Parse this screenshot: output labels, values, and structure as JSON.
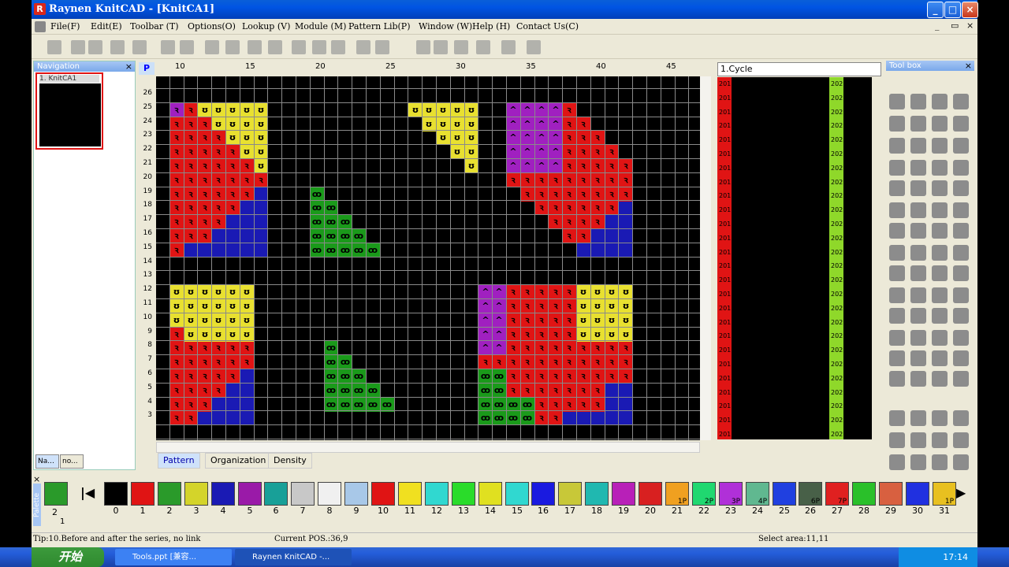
{
  "window": {
    "title": "Raynen KnitCAD - [KnitCA1]",
    "app_icon_letter": "R",
    "min": "_",
    "max": "□",
    "close": "×"
  },
  "menu": [
    "File(F)",
    "Edit(E)",
    "Toolbar (T)",
    "Options(O)",
    "Lookup (V)",
    "Module (M)",
    "Pattern Lib(P)",
    "Window (W)",
    "Help (H)",
    "Contact Us(C)"
  ],
  "navigation": {
    "title": "Navigation",
    "item": "1. KnitCA1",
    "tabs": [
      "Na...",
      "no..."
    ]
  },
  "editor": {
    "p_button": "P",
    "col_ticks": [
      "10",
      "15",
      "20",
      "25",
      "30",
      "35",
      "40",
      "45"
    ],
    "row_labels": [
      "26",
      "25",
      "24",
      "23",
      "22",
      "21",
      "20",
      "19",
      "18",
      "17",
      "16",
      "15",
      "14",
      "13",
      "12",
      "11",
      "10",
      "9",
      "8",
      "7",
      "6",
      "5",
      "4",
      "3"
    ],
    "tabs": [
      "Pattern",
      "Organization",
      "Density"
    ]
  },
  "cycle": {
    "selected": "1.Cycle",
    "left_code": "201",
    "right_code": "202"
  },
  "toolbox": {
    "title": "Tool box"
  },
  "palette": {
    "title": "Palette",
    "current_index": "2",
    "current_sub": "1",
    "numbers": [
      "0",
      "1",
      "2",
      "3",
      "4",
      "5",
      "6",
      "7",
      "8",
      "9",
      "10",
      "11",
      "12",
      "13",
      "14",
      "15",
      "16",
      "17",
      "18",
      "19",
      "20",
      "21",
      "22",
      "23",
      "24",
      "25",
      "26",
      "27",
      "28",
      "29",
      "30",
      "31"
    ],
    "colors": [
      "#000000",
      "#e01414",
      "#2a9a2a",
      "#d4d42a",
      "#1a1ab4",
      "#9a1aa8",
      "#18a098",
      "#c8c8c8",
      "#f0f0f0",
      "#a8c8e8",
      "#e01414",
      "#f0e020",
      "#30d8d0",
      "#2adc2a",
      "#e0e020",
      "#30d8d0",
      "#1a1ae0",
      "#c8c838",
      "#20b8b0",
      "#b820b8",
      "#d82020",
      "#f0a020",
      "#20d870",
      "#b030d8",
      "#60b890",
      "#2040e0",
      "#486048",
      "#e02020",
      "#2ac02a",
      "#d86040",
      "#2030e0",
      "#e8c020"
    ],
    "badges": {
      "21": "1P",
      "22": "2P",
      "23": "3P",
      "24": "4P",
      "26": "6P",
      "27": "7P",
      "31": "1P"
    }
  },
  "status": {
    "tip": "Tip:10.Before and after the series, no link",
    "pos": "Current POS.:36,9",
    "select": "Select area:11,11"
  },
  "taskbar": {
    "start": "开始",
    "tasks": [
      "Tools.ppt [兼容...",
      "Raynen KnitCAD -..."
    ],
    "clock": "17:14"
  }
}
